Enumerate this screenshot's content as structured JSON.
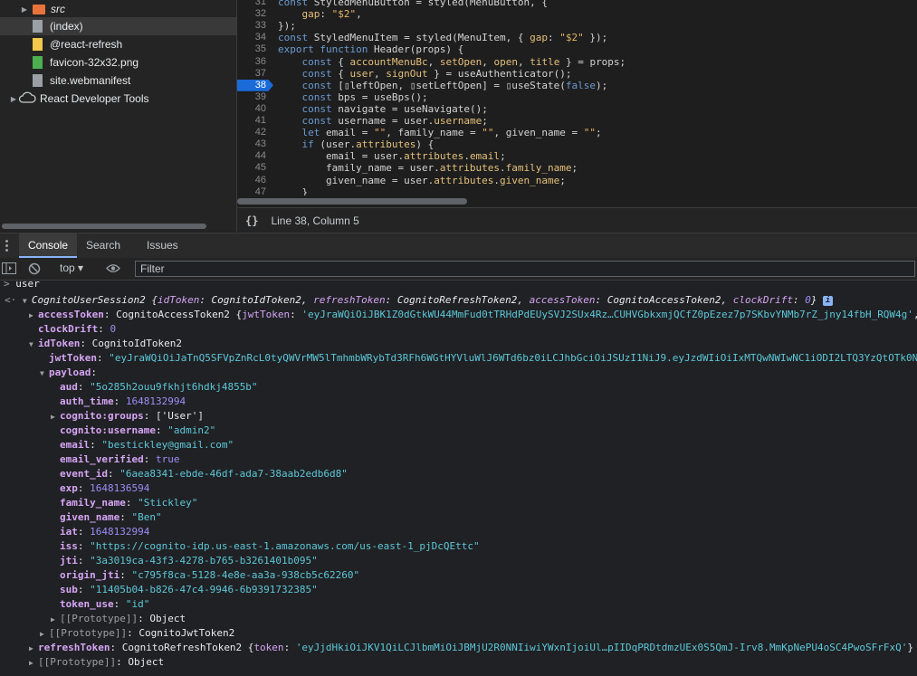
{
  "tree": {
    "items": [
      {
        "label": "src",
        "italic": true,
        "kind": "folder",
        "arrow": "▶"
      },
      {
        "label": "(index)",
        "kind": "file-gray",
        "selected": true
      },
      {
        "label": "@react-refresh",
        "kind": "file-yellow"
      },
      {
        "label": "favicon-32x32.png",
        "kind": "file-green"
      },
      {
        "label": "site.webmanifest",
        "kind": "file-gray"
      },
      {
        "label": "React Developer Tools",
        "kind": "cloud",
        "arrow": "▶"
      }
    ]
  },
  "editor": {
    "active_line": "38",
    "lines": [
      {
        "n": "31",
        "html": "<span class='kw2'>const</span> StyledMenuButton = styled(MenuButton, {"
      },
      {
        "n": "32",
        "html": "    <span class='prop'>gap</span>: <span class='str'>\"$2\"</span>,"
      },
      {
        "n": "33",
        "html": "});"
      },
      {
        "n": "34",
        "html": "<span class='kw2'>const</span> StyledMenuItem = styled(MenuItem, { <span class='prop'>gap</span>: <span class='str'>\"$2\"</span> });"
      },
      {
        "n": "35",
        "html": "<span class='kw2'>export function</span> Header(props) {"
      },
      {
        "n": "36",
        "html": "    <span class='kw2'>const</span> { <span class='prop'>accountMenuBc</span>, <span class='prop'>setOpen</span>, <span class='prop'>open</span>, <span class='prop'>title</span> } = props;"
      },
      {
        "n": "37",
        "html": "    <span class='kw2'>const</span> { <span class='prop'>user</span>, <span class='prop'>signOut</span> } = useAuthenticator();"
      },
      {
        "n": "38",
        "html": "    <span class='kw2'>const</span> [▯leftOpen, ▯setLeftOpen] = ▯useState(<span class='kw2'>false</span>);"
      },
      {
        "n": "39",
        "html": "    <span class='kw2'>const</span> bps = useBps();"
      },
      {
        "n": "40",
        "html": "    <span class='kw2'>const</span> navigate = useNavigate();"
      },
      {
        "n": "41",
        "html": "    <span class='kw2'>const</span> username = user.<span class='prop'>username</span>;"
      },
      {
        "n": "42",
        "html": "    <span class='kw2'>let</span> email = <span class='str'>\"\"</span>, family_name = <span class='str'>\"\"</span>, given_name = <span class='str'>\"\"</span>;"
      },
      {
        "n": "43",
        "html": "    <span class='kw2'>if</span> (user.<span class='prop'>attributes</span>) {"
      },
      {
        "n": "44",
        "html": "        email = user.<span class='prop'>attributes</span>.<span class='prop'>email</span>;"
      },
      {
        "n": "45",
        "html": "        family_name = user.<span class='prop'>attributes</span>.<span class='prop'>family_name</span>;"
      },
      {
        "n": "46",
        "html": "        given_name = user.<span class='prop'>attributes</span>.<span class='prop'>given_name</span>;"
      },
      {
        "n": "47",
        "html": "    }"
      }
    ]
  },
  "status": {
    "braces": "{}",
    "position": "Line 38, Column 5"
  },
  "drawer": {
    "tabs": [
      "Console",
      "Search",
      "Issues"
    ],
    "active_tab": "Console"
  },
  "toolbar": {
    "context": "top ▾",
    "filter_placeholder": "Filter"
  },
  "console": {
    "input": "user",
    "lines": [
      {
        "x": 5,
        "html": "<span class='g'>&lt;·</span> <span class='tri'>▼</span><i>CognitoUserSession2 {<span class='key-n'>idToken</span>: CognitoIdToken2, <span class='key-n'>refreshToken</span>: CognitoRefreshToken2, <span class='key-n'>accessToken</span>: CognitoAccessToken2, <span class='key-n'>clockDrift</span>: <span class='numc'>0</span>}</i> <span class='info'>i</span>"
      },
      {
        "x": 32,
        "html": "<span class='tri'>▶</span><span class='key-b'>accessToken</span>: CognitoAccessToken2 {<span class='key-n'>jwtToken</span>: <span class='str-c'>'eyJraWQiOiJBK1Z0dGtkWU44MmFud0tTRHdPdEUySVJ2SUx4Rz…CUHVGbkxmjQCfZ0pEzez7p7SKbvYNMb7rZ_jny14fbH_RQW4g'</span>, …"
      },
      {
        "x": 42,
        "html": "<span class='key-b'>clockDrift</span>: <span class='numc'>0</span>"
      },
      {
        "x": 32,
        "html": "<span class='tri'>▼</span><span class='key-b'>idToken</span>: CognitoIdToken2"
      },
      {
        "x": 54,
        "html": "<span class='key-b'>jwtToken</span>: <span class='str-c'>\"eyJraWQiOiJaTnQ5SFVpZnRcL0tyQWVrMW5lTmhmbWRybTd3RFh6WGtHYVluWlJ6WTd6bz0iLCJhbGciOiJSUzI1NiJ9.eyJzdWIiOiIxMTQwNWIwNC1iODI2LTQ3YzQtOTk0N</span>"
      },
      {
        "x": 44,
        "html": "<span class='tri'>▼</span><span class='key-b'>payload</span>:"
      },
      {
        "x": 66,
        "html": "<span class='key-b'>aud</span>: <span class='str-c'>\"5o285h2ouu9fkhjt6hdkj4855b\"</span>"
      },
      {
        "x": 66,
        "html": "<span class='key-b'>auth_time</span>: <span class='numc'>1648132994</span>"
      },
      {
        "x": 56,
        "html": "<span class='tri'>▶</span><span class='key-b'>cognito:groups</span>: ['User']"
      },
      {
        "x": 66,
        "html": "<span class='key-b'>cognito:username</span>: <span class='str-c'>\"admin2\"</span>"
      },
      {
        "x": 66,
        "html": "<span class='key-b'>email</span>: <span class='str-c'>\"bestickley@gmail.com\"</span>"
      },
      {
        "x": 66,
        "html": "<span class='key-b'>email_verified</span>: <span class='numc'>true</span>"
      },
      {
        "x": 66,
        "html": "<span class='key-b'>event_id</span>: <span class='str-c'>\"6aea8341-ebde-46df-ada7-38aab2edb6d8\"</span>"
      },
      {
        "x": 66,
        "html": "<span class='key-b'>exp</span>: <span class='numc'>1648136594</span>"
      },
      {
        "x": 66,
        "html": "<span class='key-b'>family_name</span>: <span class='str-c'>\"Stickley\"</span>"
      },
      {
        "x": 66,
        "html": "<span class='key-b'>given_name</span>: <span class='str-c'>\"Ben\"</span>"
      },
      {
        "x": 66,
        "html": "<span class='key-b'>iat</span>: <span class='numc'>1648132994</span>"
      },
      {
        "x": 66,
        "html": "<span class='key-b'>iss</span>: <span class='str-c'>\"https://cognito-idp.us-east-1.amazonaws.com/us-east-1_pjDcQEttc\"</span>"
      },
      {
        "x": 66,
        "html": "<span class='key-b'>jti</span>: <span class='str-c'>\"3a3019ca-43f3-4278-b765-b3261401b095\"</span>"
      },
      {
        "x": 66,
        "html": "<span class='key-b'>origin_jti</span>: <span class='str-c'>\"c795f8ca-5128-4e8e-aa3a-938cb5c62260\"</span>"
      },
      {
        "x": 66,
        "html": "<span class='key-b'>sub</span>: <span class='str-c'>\"11405b04-b826-47c4-9946-6b9391732385\"</span>"
      },
      {
        "x": 66,
        "html": "<span class='key-b'>token_use</span>: <span class='str-c'>\"id\"</span>"
      },
      {
        "x": 56,
        "html": "<span class='tri'>▶</span><span class='g'>[[Prototype]]</span>: Object"
      },
      {
        "x": 44,
        "html": "<span class='tri'>▶</span><span class='g'>[[Prototype]]</span>: CognitoJwtToken2"
      },
      {
        "x": 32,
        "html": "<span class='tri'>▶</span><span class='key-b'>refreshToken</span>: CognitoRefreshToken2 {<span class='key-n'>token</span>: <span class='str-c'>'eyJjdHkiOiJKV1QiLCJlbmMiOiJBMjU2R0NNIiwiYWxnIjoiUl…pIIDqPRDtdmzUEx0S5QmJ-Irv8.MmKpNePU4oSC4PwoSFrFxQ'</span>}"
      },
      {
        "x": 32,
        "html": "<span class='tri'>▶</span><span class='g'>[[Prototype]]</span>: Object"
      }
    ]
  }
}
